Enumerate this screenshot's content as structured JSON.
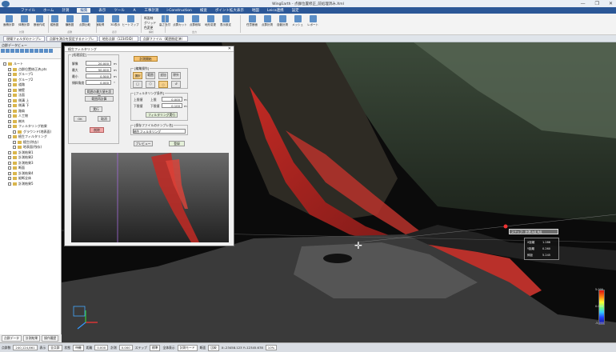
{
  "window": {
    "title": "WingEarth - 点群位置修正_前処理済み.Xml",
    "controls": [
      "—",
      "❐",
      "✕"
    ]
  },
  "menu": [
    "ファイル",
    "ホーム",
    "計測",
    "編集",
    "表示",
    "ツール",
    "Ａ",
    "工事計測",
    "i-Construction",
    "検査",
    "ポイント拡大表示",
    "地図",
    "Leica連携",
    "設定"
  ],
  "menu_active_index": 3,
  "ribbon": {
    "buttons": [
      "面積計算",
      "体積計算",
      "断面作成",
      "縦断図",
      "横断図",
      "点群比較",
      "面取得",
      "3D表示",
      "ヒートマップ",
      "高さ色付",
      "点群カット",
      "点群削除",
      "地形変更",
      "表示設定",
      "任意断面",
      "点群計測",
      "自動計測",
      "メッシュ",
      "レポート"
    ],
    "checkboxes": [
      "断面線",
      "グリッド",
      "色変更"
    ],
    "group_labels": [
      "計測",
      "点群",
      "表示",
      "解析",
      "出力"
    ]
  },
  "doc_tabs": [
    "現場フォルダのテンプレ",
    "点群を測点を設定するテンプレ",
    "地形点群（12345ID）",
    "点群ファイル（範囲指定済）"
  ],
  "sidebar": {
    "title": "点群データビュー",
    "items": [
      {
        "label": "ルート",
        "level": 0
      },
      {
        "label": "点群位置修正済.pts",
        "level": 1
      },
      {
        "label": "グループ1",
        "level": 1
      },
      {
        "label": "グループ2",
        "level": 1
      },
      {
        "label": "道路",
        "level": 1
      },
      {
        "label": "擁壁",
        "level": 1
      },
      {
        "label": "法面",
        "level": 1
      },
      {
        "label": "側溝 上",
        "level": 1
      },
      {
        "label": "側溝 下",
        "level": 1
      },
      {
        "label": "路肩",
        "level": 1
      },
      {
        "label": "人工物",
        "level": 1
      },
      {
        "label": "樹木",
        "level": 1
      },
      {
        "label": "フィルタリング結果",
        "level": 1
      },
      {
        "label": "グラウンド(地表面)",
        "level": 2
      },
      {
        "label": "植生フィルタリング",
        "level": 1
      },
      {
        "label": "植生(除去)",
        "level": 2
      },
      {
        "label": "地表面(残存)",
        "level": 2
      },
      {
        "label": "計測結果1",
        "level": 1
      },
      {
        "label": "計測結果2",
        "level": 1
      },
      {
        "label": "計測結果3",
        "level": 1
      },
      {
        "label": "断面",
        "level": 1
      },
      {
        "label": "計測結果4",
        "level": 1
      },
      {
        "label": "縦断全体",
        "level": 1
      },
      {
        "label": "計測結果5",
        "level": 1
      }
    ],
    "bottom_tabs": [
      "点群データ",
      "計測結果",
      "操作履歴"
    ]
  },
  "dialog": {
    "title": "植生フィルタリング",
    "close": "✕",
    "params_group": "[処理設定]",
    "fields": [
      {
        "label": "解像",
        "value": "20.000",
        "unit": "m"
      },
      {
        "label": "最大",
        "value": "50.000",
        "unit": "m"
      },
      {
        "label": "最小",
        "value": "0.500",
        "unit": "m"
      },
      {
        "label": "傾斜角度",
        "value": "0.000",
        "unit": "°"
      }
    ],
    "buttons": {
      "apply_range": "範囲の最大値を設定",
      "recalc": "範囲再計算",
      "run": "実行",
      "ok": "OK",
      "cancel": "取消",
      "delete": "削除",
      "start": "計測開始",
      "preview": "プレビュー",
      "register": "登録"
    },
    "mode_group": "[編集操作]",
    "mode_tabs": [
      "選択",
      "範囲",
      "追加",
      "除外"
    ],
    "region_group": "[フィルタリング条件]",
    "region_fields": [
      {
        "label": "上限",
        "value": "0.000",
        "unit": "m"
      },
      {
        "label": "下限値",
        "value": "0.100",
        "unit": "m"
      }
    ],
    "region_toggle": [
      "上限値",
      "下限値"
    ],
    "region_button": "フィルタリング実行",
    "name_group": "[保存ファイルのテンプレ名]",
    "name_value": "植生フィルタリング"
  },
  "viewport": {
    "measurement_label": "ステップ：計測  A点  B点",
    "info_rows": [
      {
        "label": "X距離",
        "value": "1.286"
      },
      {
        "label": "Y距離",
        "value": "0.260"
      },
      {
        "label": "斜距",
        "value": "5.245"
      }
    ],
    "scale": {
      "max": "5.000",
      "mid": "0.000",
      "min": "-5.000"
    },
    "axes": [
      "X",
      "Y",
      "Z"
    ]
  },
  "statusbar": {
    "items": [
      "点群数",
      "240,124,861",
      "表示",
      "全点群",
      "状態",
      "待機",
      "距離",
      "0.000",
      "計測",
      "0.000",
      "ステップ",
      "標準",
      "全体表示",
      "計測モード",
      "断面",
      "比較"
    ],
    "coords": "X:-23458.123  Y:-12345.678",
    "zoom": "10%"
  },
  "colors": {
    "accent": "#2b5797",
    "vegetation_red": "#d23a30",
    "orange_button": "#f5c16e"
  }
}
